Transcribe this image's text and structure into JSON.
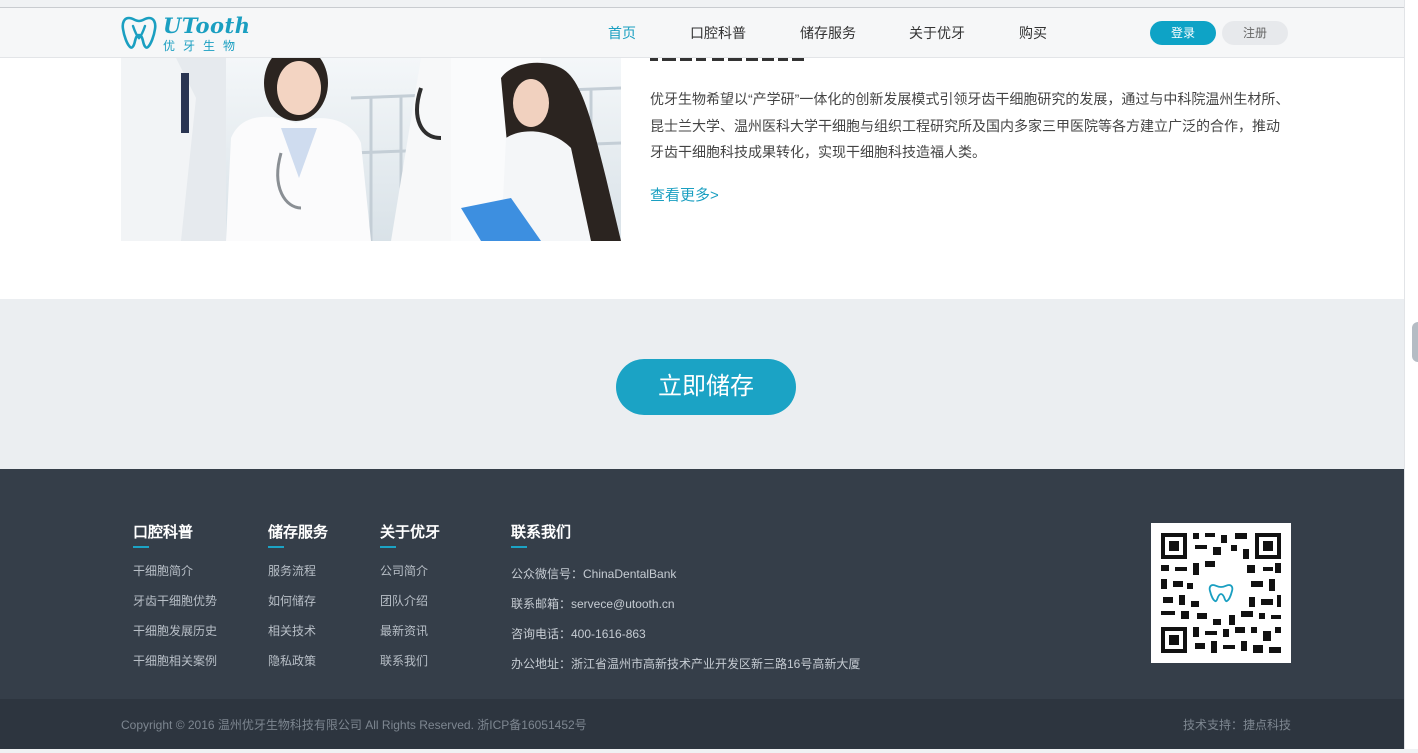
{
  "brand": {
    "name": "UTooth",
    "sub": "优牙生物",
    "accent": "#1a9fc1"
  },
  "nav": {
    "items": [
      "首页",
      "口腔科普",
      "储存服务",
      "关于优牙",
      "购买"
    ],
    "active": "首页",
    "login": "登录",
    "register": "注册"
  },
  "about": {
    "paragraph": "优牙生物希望以“产学研”一体化的创新发展模式引领牙齿干细胞研究的发展，通过与中科院温州生材所、昆士兰大学、温州医科大学干细胞与组织工程研究所及国内多家三甲医院等各方建立广泛的合作，推动牙齿干细胞科技成果转化，实现干细胞科技造福人类。",
    "more": "查看更多>"
  },
  "cta": {
    "label": "立即储存"
  },
  "footer": {
    "col1": {
      "title": "口腔科普",
      "links": [
        "干细胞简介",
        "牙齿干细胞优势",
        "干细胞发展历史",
        "干细胞相关案例"
      ]
    },
    "col2": {
      "title": "储存服务",
      "links": [
        "服务流程",
        "如何储存",
        "相关技术",
        "隐私政策"
      ]
    },
    "col3": {
      "title": "关于优牙",
      "links": [
        "公司简介",
        "团队介绍",
        "最新资讯",
        "联系我们"
      ]
    },
    "contact": {
      "title": "联系我们",
      "wechat": "公众微信号：ChinaDentalBank",
      "email": "联系邮箱：servece@utooth.cn",
      "phone": "咨询电话：400-1616-863",
      "address": "办公地址：浙江省温州市高新技术产业开发区新三路16号高新大厦"
    },
    "copyright": "Copyright © 2016 温州优牙生物科技有限公司 All Rights Reserved. 浙ICP备16051452号",
    "support": "技术支持：捷点科技"
  }
}
